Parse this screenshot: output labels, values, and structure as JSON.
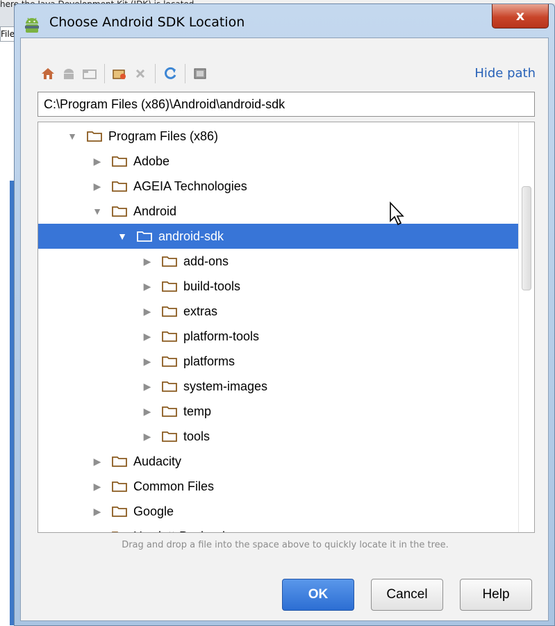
{
  "background": {
    "partial_text": "here the Java Development Kit (JDK) is located",
    "partial_field": "Files"
  },
  "window": {
    "title": "Choose Android SDK Location",
    "close_label": "x"
  },
  "toolbar": {
    "icons": [
      "home-icon",
      "android-icon",
      "project-icon",
      "new-folder-icon",
      "delete-icon",
      "refresh-icon",
      "show-hidden-icon"
    ],
    "hide_path_label": "Hide path"
  },
  "path": {
    "value": "C:\\Program Files (x86)\\Android\\android-sdk"
  },
  "tree": {
    "rows": [
      {
        "label": "Program Files (x86)",
        "depth": 0,
        "expanded": true
      },
      {
        "label": "Adobe",
        "depth": 1,
        "expanded": false
      },
      {
        "label": "AGEIA Technologies",
        "depth": 1,
        "expanded": false
      },
      {
        "label": "Android",
        "depth": 1,
        "expanded": true
      },
      {
        "label": "android-sdk",
        "depth": 2,
        "expanded": true,
        "selected": true
      },
      {
        "label": "add-ons",
        "depth": 3,
        "expanded": false
      },
      {
        "label": "build-tools",
        "depth": 3,
        "expanded": false
      },
      {
        "label": "extras",
        "depth": 3,
        "expanded": false
      },
      {
        "label": "platform-tools",
        "depth": 3,
        "expanded": false
      },
      {
        "label": "platforms",
        "depth": 3,
        "expanded": false
      },
      {
        "label": "system-images",
        "depth": 3,
        "expanded": false
      },
      {
        "label": "temp",
        "depth": 3,
        "expanded": false
      },
      {
        "label": "tools",
        "depth": 3,
        "expanded": false
      },
      {
        "label": "Audacity",
        "depth": 1,
        "expanded": false
      },
      {
        "label": "Common Files",
        "depth": 1,
        "expanded": false
      },
      {
        "label": "Google",
        "depth": 1,
        "expanded": false
      },
      {
        "label": "Hewlett-Packard",
        "depth": 1,
        "expanded": false
      }
    ]
  },
  "hint": "Drag and drop a file into the space above to quickly locate it in the tree.",
  "buttons": {
    "ok": "OK",
    "cancel": "Cancel",
    "help": "Help"
  },
  "colors": {
    "selection": "#3875d7",
    "link": "#2862b8",
    "folder": "#8a5a1e",
    "primary_button": "#2c6ed3"
  }
}
